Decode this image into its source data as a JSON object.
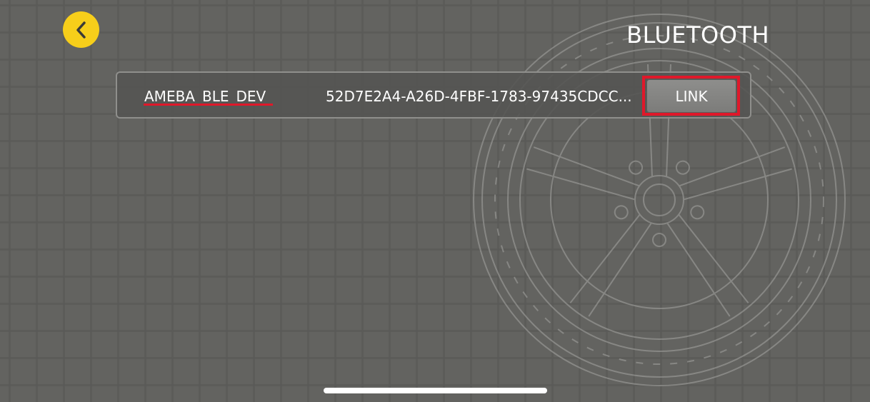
{
  "header": {
    "title": "BLUETOOTH",
    "back_icon": "chevron-left-icon"
  },
  "devices": [
    {
      "name": "AMEBA_BLE_DEV",
      "uuid": "52D7E2A4-A26D-4FBF-1783-97435CDCC...",
      "link_label": "LINK"
    }
  ],
  "colors": {
    "accent_yellow": "#f7ce1a",
    "highlight_red": "#e0182a",
    "background": "#636360"
  },
  "background_art": "car-wheel-watermark"
}
